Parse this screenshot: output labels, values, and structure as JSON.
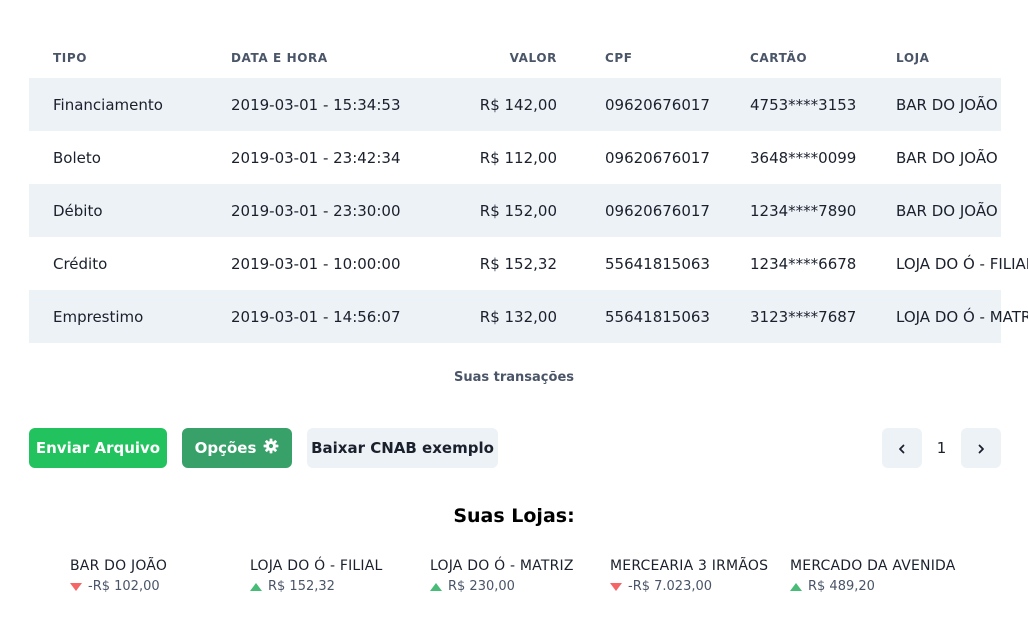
{
  "table": {
    "headers": [
      "TIPO",
      "DATA E HORA",
      "VALOR",
      "CPF",
      "CARTÃO",
      "LOJA"
    ],
    "rows": [
      [
        "Financiamento",
        "2019-03-01 - 15:34:53",
        "R$ 142,00",
        "09620676017",
        "4753****3153",
        "BAR DO JOÃO"
      ],
      [
        "Boleto",
        "2019-03-01 - 23:42:34",
        "R$ 112,00",
        "09620676017",
        "3648****0099",
        "BAR DO JOÃO"
      ],
      [
        "Débito",
        "2019-03-01 - 23:30:00",
        "R$ 152,00",
        "09620676017",
        "1234****7890",
        "BAR DO JOÃO"
      ],
      [
        "Crédito",
        "2019-03-01 - 10:00:00",
        "R$ 152,32",
        "55641815063",
        "1234****6678",
        "LOJA DO Ó - FILIAL"
      ],
      [
        "Emprestimo",
        "2019-03-01 - 14:56:07",
        "R$ 132,00",
        "55641815063",
        "3123****7687",
        "LOJA DO Ó - MATRIZ"
      ]
    ],
    "caption": "Suas transações"
  },
  "actions": {
    "send_label": "Enviar Arquivo",
    "options_label": "Opções",
    "cnab_label": "Baixar CNAB exemplo"
  },
  "pagination": {
    "current_page": "1"
  },
  "stores": {
    "title": "Suas Lojas:",
    "items": [
      {
        "name": "BAR DO JOÃO",
        "value": "-R$ 102,00",
        "trend": "down"
      },
      {
        "name": "LOJA DO Ó - FILIAL",
        "value": "R$ 152,32",
        "trend": "up"
      },
      {
        "name": "LOJA DO Ó - MATRIZ",
        "value": "R$ 230,00",
        "trend": "up"
      },
      {
        "name": "MERCEARIA 3 IRMÃOS",
        "value": "-R$ 7.023,00",
        "trend": "down"
      },
      {
        "name": "MERCADO DA AVENIDA",
        "value": "R$ 489,20",
        "trend": "up"
      }
    ]
  },
  "colors": {
    "primary_green": "#22c35e",
    "secondary_green": "#38a169",
    "stripe": "#edf2f7",
    "trend_up": "#48bb78",
    "trend_down": "#f56565"
  },
  "icons": {
    "options_button": "gear-icon",
    "pagination_prev": "chevron-left-icon",
    "pagination_next": "chevron-right-icon",
    "trend_up": "triangle-up-icon",
    "trend_down": "triangle-down-icon"
  }
}
